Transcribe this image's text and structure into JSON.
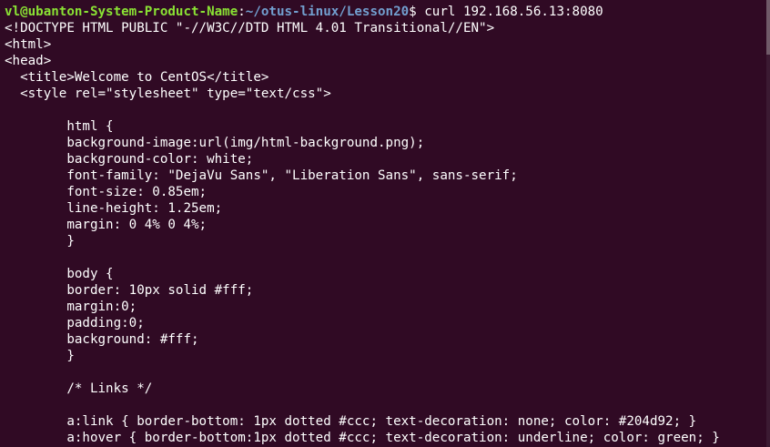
{
  "terminal": {
    "background": "#300a24",
    "prompt": {
      "user_host": "vl@ubanton-System-Product-Name",
      "separator": ":",
      "path": "~/otus-linux/Lesson20",
      "dollar": "$ ",
      "command": "curl 192.168.56.13:8080"
    },
    "output_lines": [
      "<!DOCTYPE HTML PUBLIC \"-//W3C//DTD HTML 4.01 Transitional//EN\">",
      "<html>",
      "<head>",
      "  <title>Welcome to CentOS</title>",
      "  <style rel=\"stylesheet\" type=\"text/css\">",
      "",
      "        html {",
      "        background-image:url(img/html-background.png);",
      "        background-color: white;",
      "        font-family: \"DejaVu Sans\", \"Liberation Sans\", sans-serif;",
      "        font-size: 0.85em;",
      "        line-height: 1.25em;",
      "        margin: 0 4% 0 4%;",
      "        }",
      "",
      "        body {",
      "        border: 10px solid #fff;",
      "        margin:0;",
      "        padding:0;",
      "        background: #fff;",
      "        }",
      "",
      "        /* Links */",
      "",
      "        a:link { border-bottom: 1px dotted #ccc; text-decoration: none; color: #204d92; }",
      "        a:hover { border-bottom:1px dotted #ccc; text-decoration: underline; color: green; }"
    ]
  }
}
